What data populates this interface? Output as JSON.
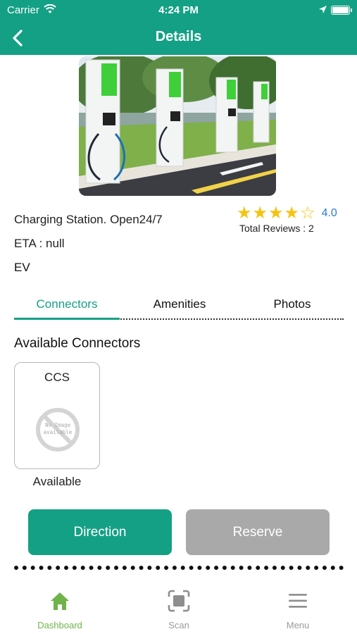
{
  "status_bar": {
    "carrier": "Carrier",
    "time": "4:24 PM",
    "icons": [
      "wifi-icon",
      "location-arrow-icon",
      "battery-icon"
    ]
  },
  "nav": {
    "title": "Details",
    "back_icon": "chevron-left-icon"
  },
  "station": {
    "name": "Charging Station. Open24/7",
    "eta": "ETA : null",
    "type": "EV",
    "rating_value": "4.0",
    "rating": 4,
    "rating_max": 5,
    "reviews": "Total Reviews : 2"
  },
  "tabs": [
    {
      "label": "Connectors",
      "active": true
    },
    {
      "label": "Amenities",
      "active": false
    },
    {
      "label": "Photos",
      "active": false
    }
  ],
  "connectors_section": {
    "title": "Available Connectors",
    "items": [
      {
        "type": "CCS",
        "status": "Available",
        "image_text": "No Image available"
      }
    ]
  },
  "actions": {
    "direction": "Direction",
    "reserve": "Reserve"
  },
  "tabbar": [
    {
      "label": "Dashboard",
      "icon": "home-icon",
      "active": true
    },
    {
      "label": "Scan",
      "icon": "scan-icon",
      "active": false
    },
    {
      "label": "Menu",
      "icon": "hamburger-menu-icon",
      "active": false
    }
  ],
  "colors": {
    "primary": "#14a085",
    "disabled": "#a9a9a9",
    "star": "#f6c312",
    "rating_text": "#2d7dd2",
    "tab_active": "#6fb34a"
  }
}
